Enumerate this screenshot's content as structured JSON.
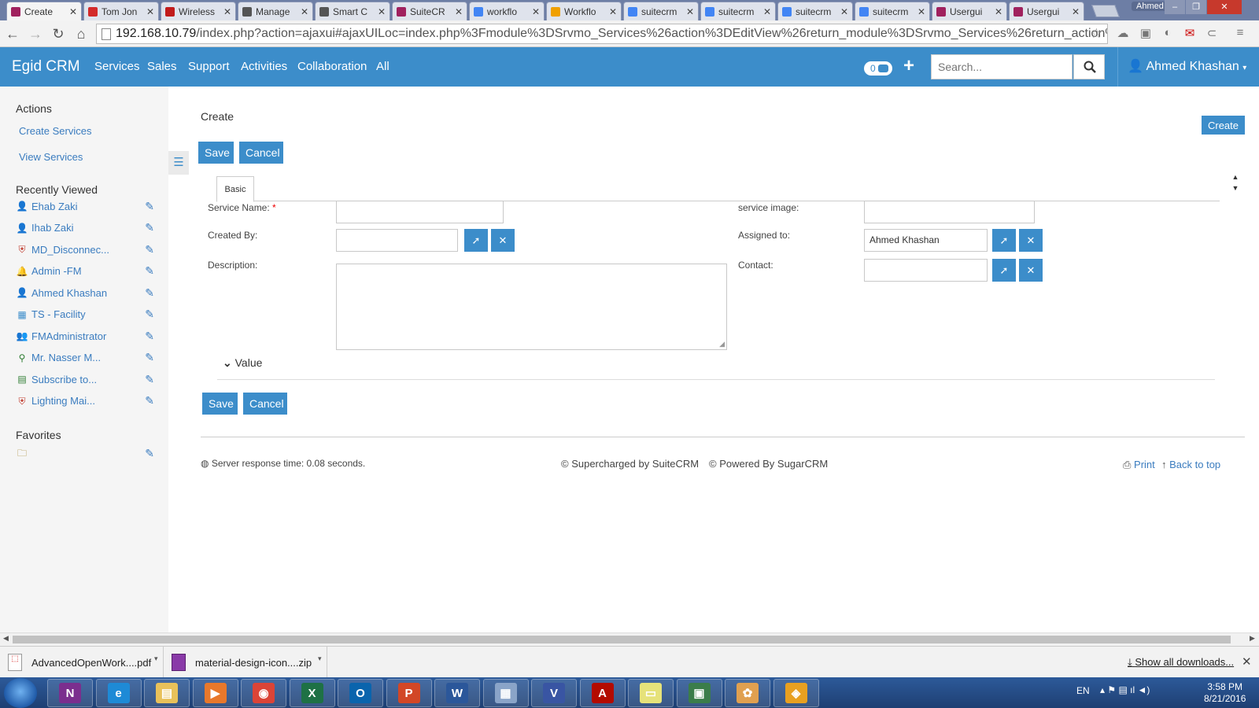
{
  "browser": {
    "tabs": [
      {
        "label": "Create",
        "icon": "suitecrm-icon",
        "color": "#a0215e",
        "active": true
      },
      {
        "label": "Tom Jon",
        "icon": "youtube-icon",
        "color": "#d32a2a"
      },
      {
        "label": "Wireless",
        "icon": "opera-icon",
        "color": "#c11b1b"
      },
      {
        "label": "Manage",
        "icon": "heart-icon",
        "color": "#555"
      },
      {
        "label": "Smart C",
        "icon": "heart-icon",
        "color": "#555"
      },
      {
        "label": "SuiteCR",
        "icon": "suitecrm-icon",
        "color": "#a0215e"
      },
      {
        "label": "workflo",
        "icon": "google-icon",
        "color": "#4285f4"
      },
      {
        "label": "Workflo",
        "icon": "sa-icon",
        "color": "#f0a000"
      },
      {
        "label": "suitecrm",
        "icon": "google-icon",
        "color": "#4285f4"
      },
      {
        "label": "suitecrm",
        "icon": "google-icon",
        "color": "#4285f4"
      },
      {
        "label": "suitecrm",
        "icon": "google-icon",
        "color": "#4285f4"
      },
      {
        "label": "suitecrm",
        "icon": "google-icon",
        "color": "#4285f4"
      },
      {
        "label": "Usergui",
        "icon": "suitecrm-icon",
        "color": "#a0215e"
      },
      {
        "label": "Usergui",
        "icon": "suitecrm-icon",
        "color": "#a0215e"
      }
    ],
    "window_user": "Ahmed",
    "url_host": "192.168.10.79",
    "url_path": "/index.php?action=ajaxui#ajaxUILoc=index.php%3Fmodule%3DSrvmo_Services%26action%3DEditView%26return_module%3DSrvmo_Services%26return_action%"
  },
  "navbar": {
    "brand": "Egid CRM",
    "menu": [
      "Services",
      "Sales",
      "Support",
      "Activities",
      "Collaboration",
      "All"
    ],
    "notification_count": "0",
    "search_placeholder": "Search...",
    "user": "Ahmed Khashan",
    "accent": "#3c8dca"
  },
  "sidebar": {
    "actions_title": "Actions",
    "actions": [
      "Create Services",
      "View Services"
    ],
    "recent_title": "Recently Viewed",
    "recent": [
      {
        "label": "Ehab Zaki",
        "icon": "contact-icon"
      },
      {
        "label": "Ihab Zaki",
        "icon": "contact-icon"
      },
      {
        "label": "MD_Disconnec...",
        "icon": "shield-icon"
      },
      {
        "label": "Admin -FM",
        "icon": "bell-icon"
      },
      {
        "label": "Ahmed Khashan",
        "icon": "contact-icon"
      },
      {
        "label": "TS - Facility",
        "icon": "calendar-icon"
      },
      {
        "label": "FMAdministrator",
        "icon": "users-group-icon"
      },
      {
        "label": "Mr. Nasser M...",
        "icon": "search-user-icon"
      },
      {
        "label": "Subscribe to...",
        "icon": "document-icon"
      },
      {
        "label": "Lighting Mai...",
        "icon": "shield-icon"
      }
    ],
    "favorites_title": "Favorites"
  },
  "form": {
    "page_title": "Create",
    "create_button": "Create",
    "save": "Save",
    "cancel": "Cancel",
    "tab_basic": "Basic",
    "service_name_label": "Service Name:",
    "required_mark": "*",
    "service_name_value": "",
    "service_image_label": "service image:",
    "created_by_label": "Created By:",
    "assigned_to_label": "Assigned to:",
    "assigned_to_value": "Ahmed Khashan",
    "description_label": "Description:",
    "contact_label": "Contact:",
    "value_panel": "Value"
  },
  "footer": {
    "server_time": "Server response time: 0.08 seconds.",
    "supercharged": "© Supercharged by SuiteCRM",
    "powered": "© Powered By SugarCRM",
    "print": "Print",
    "back_to_top": "Back to top"
  },
  "downloads": {
    "items": [
      {
        "name": "AdvancedOpenWork....pdf",
        "icon": "pdf-icon"
      },
      {
        "name": "material-design-icon....zip",
        "icon": "zip-icon"
      }
    ],
    "show_all": "Show all downloads..."
  },
  "taskbar": {
    "apps": [
      {
        "name": "onenote-icon",
        "glyph": "N",
        "color": "#7b2e8e"
      },
      {
        "name": "internet-explorer-icon",
        "glyph": "e",
        "color": "#1e8ad6"
      },
      {
        "name": "file-explorer-icon",
        "glyph": "▤",
        "color": "#e8c15a"
      },
      {
        "name": "media-player-icon",
        "glyph": "▶",
        "color": "#e8782b"
      },
      {
        "name": "chrome-icon",
        "glyph": "◉",
        "color": "#db4437"
      },
      {
        "name": "excel-icon",
        "glyph": "X",
        "color": "#1e7145"
      },
      {
        "name": "outlook-icon",
        "glyph": "O",
        "color": "#0a64ad"
      },
      {
        "name": "powerpoint-icon",
        "glyph": "P",
        "color": "#d24726"
      },
      {
        "name": "word-icon",
        "glyph": "W",
        "color": "#2b579a"
      },
      {
        "name": "calculator-icon",
        "glyph": "▦",
        "color": "#8aa4c8"
      },
      {
        "name": "visio-icon",
        "glyph": "V",
        "color": "#3955a3"
      },
      {
        "name": "acrobat-icon",
        "glyph": "A",
        "color": "#b30b00"
      },
      {
        "name": "sticky-notes-icon",
        "glyph": "▭",
        "color": "#e6e27a"
      },
      {
        "name": "movie-maker-icon",
        "glyph": "▣",
        "color": "#3b7d4a"
      },
      {
        "name": "paint-icon",
        "glyph": "✿",
        "color": "#e0a050"
      },
      {
        "name": "eye-app-icon",
        "glyph": "◈",
        "color": "#e8a020"
      }
    ],
    "language": "EN",
    "time": "3:58 PM",
    "date": "8/21/2016"
  }
}
